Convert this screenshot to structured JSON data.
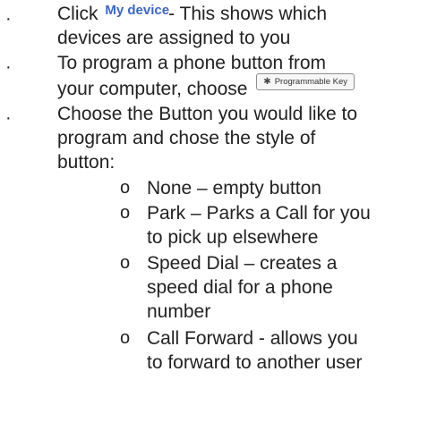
{
  "doc": {
    "bullet_glyph": "·",
    "subbullet_glyph": "o",
    "items": [
      {
        "prefix": "Click",
        "link": "My device",
        "suffix": "- This shows which",
        "line2": "devices are assigned to you"
      },
      {
        "line1": "To program a phone button from",
        "line2_prefix": "your computer, choose",
        "button_label": "Programmable Key",
        "button_icon": "gear-icon"
      },
      {
        "line1": "Choose the Button you would like to",
        "line2": "program and chose the style of",
        "line3": "button:"
      }
    ],
    "subitems": [
      {
        "line1": "None – empty button"
      },
      {
        "line1": "Park – Parks a Call for you",
        "line2": "to pick up elsewhere"
      },
      {
        "line1": "Speed Dial – creates a",
        "line2": "speed dial for a phone",
        "line3": "number"
      },
      {
        "line1": "Call Forward - allows you",
        "line2": "to forward to another user"
      }
    ],
    "colors": {
      "text": "#222222",
      "link": "#3a66c8",
      "button_border": "#8f8f8f"
    }
  }
}
